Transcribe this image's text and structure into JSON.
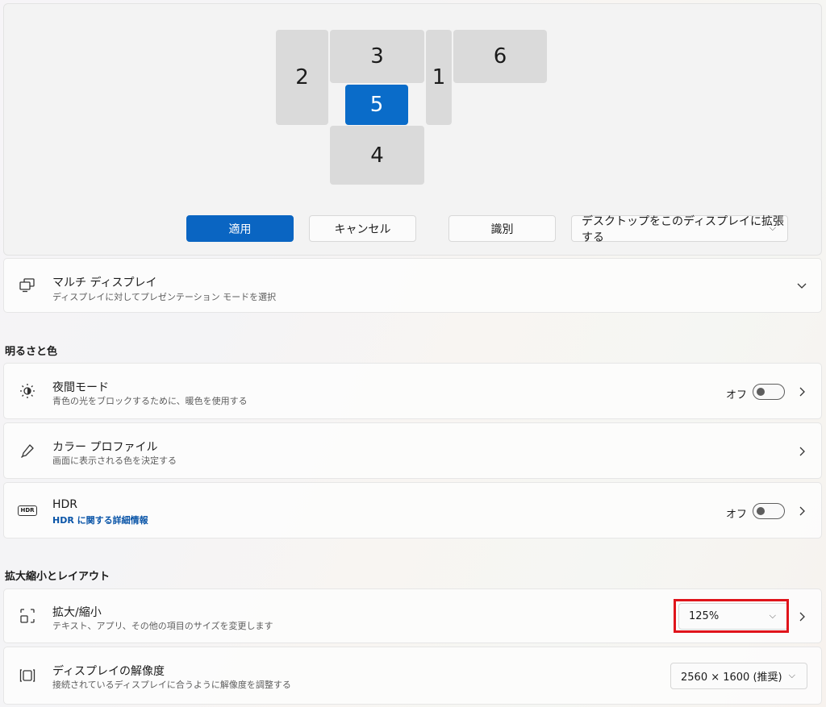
{
  "arrangement": {
    "monitors": [
      {
        "id": "mon-2",
        "label": "2",
        "selected": false
      },
      {
        "id": "mon-3",
        "label": "3",
        "selected": false
      },
      {
        "id": "mon-1",
        "label": "1",
        "selected": false
      },
      {
        "id": "mon-6",
        "label": "6",
        "selected": false
      },
      {
        "id": "mon-5",
        "label": "5",
        "selected": true
      },
      {
        "id": "mon-4",
        "label": "4",
        "selected": false
      }
    ],
    "apply_label": "適用",
    "cancel_label": "キャンセル",
    "identify_label": "識別",
    "extend_label": "デスクトップをこのディスプレイに拡張する"
  },
  "multi_display": {
    "title": "マルチ ディスプレイ",
    "subtitle": "ディスプレイに対してプレゼンテーション モードを選択"
  },
  "brightness_section": {
    "heading": "明るさと色",
    "night_mode": {
      "title": "夜間モード",
      "subtitle": "青色の光をブロックするために、暖色を使用する",
      "state": "オフ"
    },
    "color_profile": {
      "title": "カラー プロファイル",
      "subtitle": "画面に表示される色を決定する"
    },
    "hdr": {
      "title": "HDR",
      "link": "HDR に関する詳細情報",
      "state": "オフ",
      "icon_text": "HDR"
    }
  },
  "scale_section": {
    "heading": "拡大縮小とレイアウト",
    "scale": {
      "title": "拡大/縮小",
      "subtitle": "テキスト、アプリ、その他の項目のサイズを変更します",
      "value": "125%"
    },
    "resolution": {
      "title": "ディスプレイの解像度",
      "subtitle": "接続されているディスプレイに合うように解像度を調整する",
      "value": "2560 × 1600 (推奨)"
    }
  },
  "colors": {
    "accent": "#0a65c2",
    "highlight": "#e0141b"
  }
}
